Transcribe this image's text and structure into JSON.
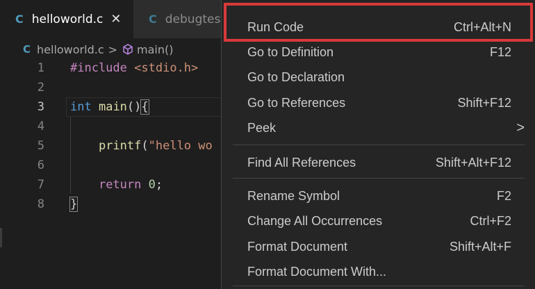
{
  "tabs": [
    {
      "icon": "C",
      "label": "helloworld.c",
      "close": "✕"
    },
    {
      "icon": "C",
      "label": "debugtest"
    }
  ],
  "breadcrumb": {
    "icon": "C",
    "file": "helloworld.c",
    "separator": ">",
    "symbol": "main()"
  },
  "editor": {
    "current_line": 3,
    "lines": [
      {
        "n": "1",
        "code": "#include <stdio.h>"
      },
      {
        "n": "2",
        "code": ""
      },
      {
        "n": "3",
        "code": "int main(){"
      },
      {
        "n": "4",
        "code": ""
      },
      {
        "n": "5",
        "code": "    printf(\"hello wo"
      },
      {
        "n": "6",
        "code": ""
      },
      {
        "n": "7",
        "code": "    return 0;"
      },
      {
        "n": "8",
        "code": "}"
      }
    ]
  },
  "context_menu": {
    "items": [
      {
        "label": "Run Code",
        "shortcut": "Ctrl+Alt+N",
        "highlighted": true
      },
      {
        "label": "Go to Definition",
        "shortcut": "F12"
      },
      {
        "label": "Go to Declaration",
        "shortcut": ""
      },
      {
        "label": "Go to References",
        "shortcut": "Shift+F12"
      },
      {
        "label": "Peek",
        "shortcut": "",
        "submenu": ">"
      },
      {
        "label": "Find All References",
        "shortcut": "Shift+Alt+F12"
      },
      {
        "label": "Rename Symbol",
        "shortcut": "F2"
      },
      {
        "label": "Change All Occurrences",
        "shortcut": "Ctrl+F2"
      },
      {
        "label": "Format Document",
        "shortcut": "Shift+Alt+F"
      },
      {
        "label": "Format Document With...",
        "shortcut": ""
      }
    ]
  },
  "colors": {
    "highlight_border": "#d83a3a",
    "menu_background": "#252526",
    "editor_background": "#1e1e1e"
  }
}
